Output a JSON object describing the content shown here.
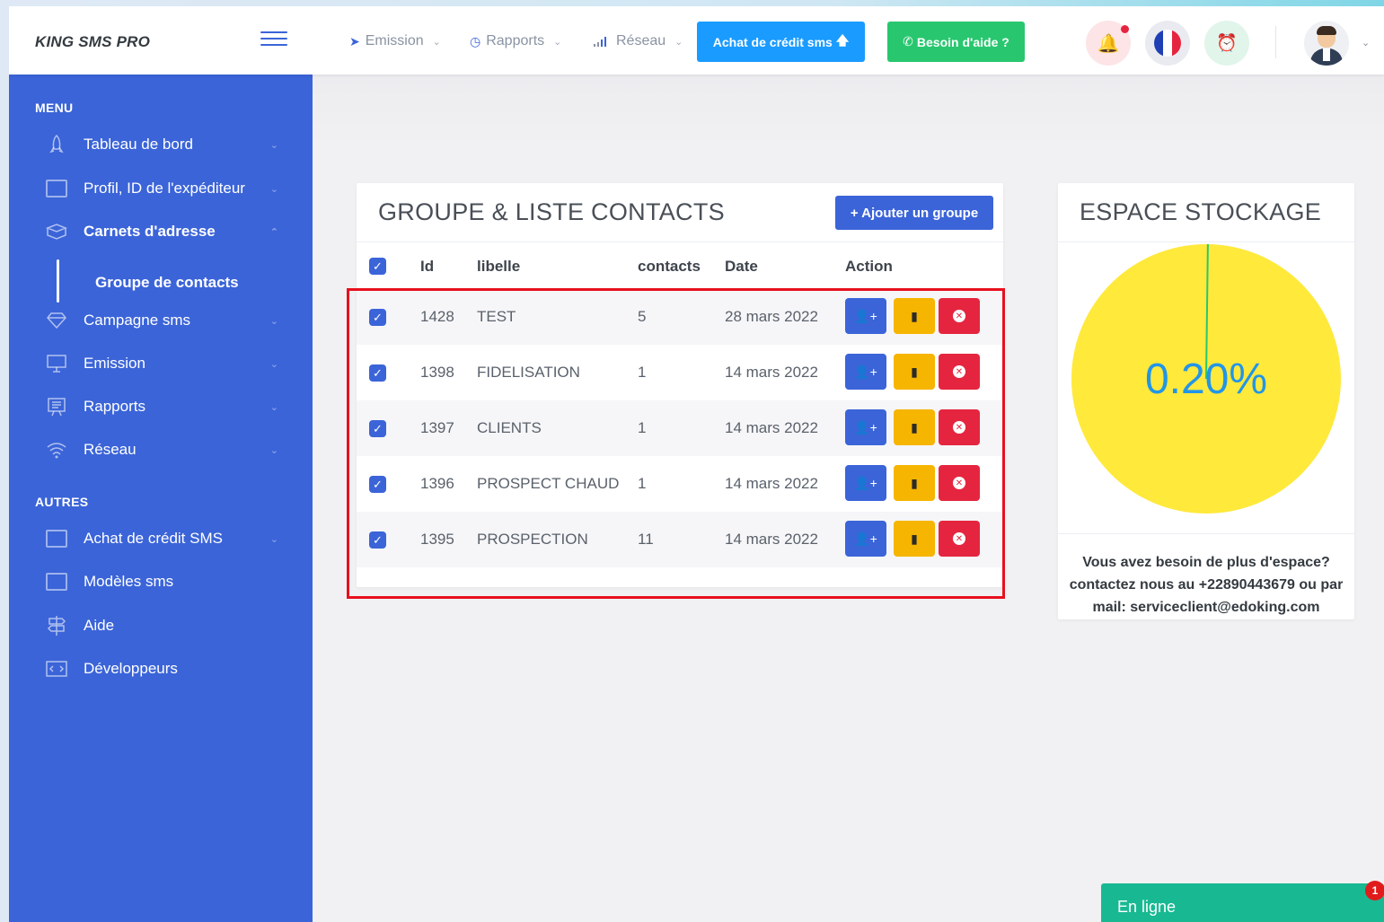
{
  "header": {
    "brand": "KING SMS PRO",
    "nav": [
      {
        "label": "Emission",
        "icon": "send-icon"
      },
      {
        "label": "Rapports",
        "icon": "clock-icon"
      },
      {
        "label": "Réseau",
        "icon": "signal-icon"
      }
    ],
    "credit_button": "Achat de crédit sms",
    "help_button": "Besoin d'aide ?",
    "icons": [
      "bell-icon",
      "france-flag-icon",
      "alarm-clock-icon",
      "user-avatar-icon"
    ],
    "colors": {
      "primary": "#3b64d8",
      "credit": "#1a9bff",
      "help": "#28c76f",
      "danger": "#e5253f",
      "warning": "#f6b500"
    }
  },
  "sidebar": {
    "menu_title": "MENU",
    "others_title": "AUTRES",
    "items": [
      {
        "label": "Tableau de bord",
        "icon": "rocket-icon"
      },
      {
        "label": "Profil, ID de l'expéditeur",
        "icon": "window-icon"
      },
      {
        "label": "Carnets d'adresse",
        "icon": "package-icon"
      },
      {
        "label": "Campagne sms",
        "icon": "diamond-icon"
      },
      {
        "label": "Emission",
        "icon": "monitor-icon"
      },
      {
        "label": "Rapports",
        "icon": "presentation-icon"
      },
      {
        "label": "Réseau",
        "icon": "wifi-icon"
      }
    ],
    "sub_item": "Groupe de contacts",
    "other_items": [
      {
        "label": "Achat de crédit SMS",
        "icon": "card-icon"
      },
      {
        "label": "Modèles sms",
        "icon": "window-icon"
      },
      {
        "label": "Aide",
        "icon": "signpost-icon"
      },
      {
        "label": "Développeurs",
        "icon": "code-icon"
      }
    ]
  },
  "contacts": {
    "title": "GROUPE & LISTE CONTACTS",
    "add_button": "+ Ajouter un groupe",
    "columns": [
      "Id",
      "libelle",
      "contacts",
      "Date",
      "Action"
    ],
    "rows": [
      {
        "id": "1428",
        "libelle": "TEST",
        "contacts": "5",
        "date": "28 mars 2022"
      },
      {
        "id": "1398",
        "libelle": "FIDELISATION",
        "contacts": "1",
        "date": "14 mars 2022"
      },
      {
        "id": "1397",
        "libelle": "CLIENTS",
        "contacts": "1",
        "date": "14 mars 2022"
      },
      {
        "id": "1396",
        "libelle": "PROSPECT CHAUD",
        "contacts": "1",
        "date": "14 mars 2022"
      },
      {
        "id": "1395",
        "libelle": "PROSPECTION",
        "contacts": "11",
        "date": "14 mars 2022"
      }
    ]
  },
  "storage": {
    "title": "ESPACE STOCKAGE",
    "percent_label": "0.20%",
    "used_fraction": 0.002,
    "pie_color": "#ffe93b",
    "used_color": "#28c76f",
    "text_line1": "Vous avez besoin de plus d'espace?",
    "text_line2": "contactez nous au +22890443679 ou par",
    "text_line3": "mail: serviceclient@edoking.com"
  },
  "online": {
    "label": "En ligne",
    "badge": "1"
  }
}
